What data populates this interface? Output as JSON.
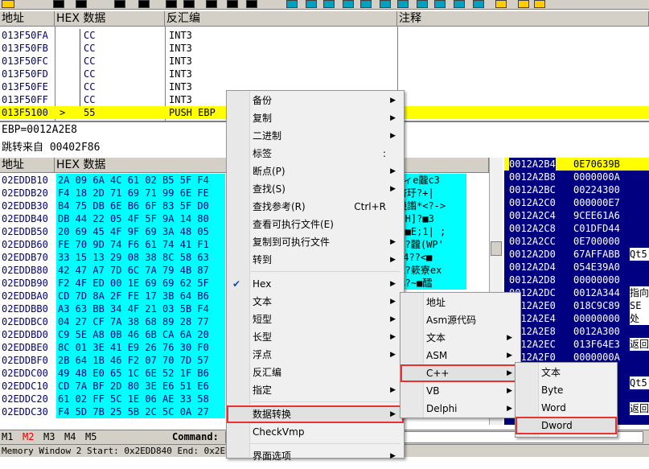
{
  "colors": {
    "cyan": "#00ffff",
    "navy": "#000080",
    "eip_yellow": "#ffff00",
    "menu_bg": "#f0f0f0",
    "highlight_red": "#e53333"
  },
  "disasm": {
    "headers": {
      "addr": "地址",
      "hex": "HEX 数据",
      "dis": "反汇编",
      "cmt": "注释"
    },
    "rows": [
      {
        "addr": "013F50FA",
        "hex": "CC",
        "dis": "INT3"
      },
      {
        "addr": "013F50FB",
        "hex": "CC",
        "dis": "INT3"
      },
      {
        "addr": "013F50FC",
        "hex": "CC",
        "dis": "INT3"
      },
      {
        "addr": "013F50FD",
        "hex": "CC",
        "dis": "INT3"
      },
      {
        "addr": "013F50FE",
        "hex": "CC",
        "dis": "INT3"
      },
      {
        "addr": "013F50FF",
        "hex": "CC",
        "dis": "INT3"
      },
      {
        "addr": "013F5100",
        "hex": "55",
        "dis": "PUSH EBP",
        "arrow": ">",
        "current": true
      }
    ]
  },
  "info": {
    "line1": "EBP=0012A2E8",
    "line2": "跳转来自  00402F86"
  },
  "dump": {
    "headers": {
      "addr": "地址",
      "hex": "HEX 数据"
    },
    "rows": [
      {
        "addr": "02EDDB10",
        "hex": "2A 09 6A 4C 61 02 B5 5F F4",
        "txt": "*磌ィe龖c3"
      },
      {
        "addr": "02EDDB20",
        "hex": "F4 18 2D 71 69 71 99 6E FE",
        "txt": "當脐玗?+|"
      },
      {
        "addr": "02EDDB30",
        "hex": "B4 75 DB 6E B6 6F 83 5F D0",
        "txt": "唚機譾*<?->"
      },
      {
        "addr": "02EDDB40",
        "hex": "DB 44 22 05 4F 5F 9A 14 80",
        "txt": "?@eH]?■3"
      },
      {
        "addr": "02EDDB50",
        "hex": "20 69 45 4F 9F 69 3A 48 05",
        "txt": "|:H■E;1| ;"
      },
      {
        "addr": "02EDDB60",
        "hex": "FE 70 9D 74 F6 61 74 41 F1",
        "txt": "lta?龖(WP'"
      },
      {
        "addr": "02EDDB70",
        "hex": "33 15 13 29 08 38 8C 58 63",
        "txt": "學V4??<■"
      },
      {
        "addr": "02EDDB80",
        "hex": "42 47 A7 7D 6C 7A 79 4B 87",
        "txt": "zyK?簌寮ex"
      },
      {
        "addr": "02EDDB90",
        "hex": "F2 4F ED 00 1E 69 69 62 5F",
        "txt": "b_%?~■醽"
      },
      {
        "addr": "02EDDBA0",
        "hex": "CD 7D 8A 2F FE 17 3B 64 B6",
        "txt": ""
      },
      {
        "addr": "02EDDBB0",
        "hex": "A3 63 BB 34 4F 21 03 5B F4",
        "txt": ""
      },
      {
        "addr": "02EDDBC0",
        "hex": "04 27 CF 7A 38 68 89 28 77",
        "txt": ""
      },
      {
        "addr": "02EDDBD0",
        "hex": "C9 5E A8 0B 46 6B CA 6A 20",
        "txt": ""
      },
      {
        "addr": "02EDDBE0",
        "hex": "8C 01 3E 41 E9 26 76 30 F0",
        "txt": ""
      },
      {
        "addr": "02EDDBF0",
        "hex": "2B 64 1B 46 F2 07 70 7D 57",
        "txt": ""
      },
      {
        "addr": "02EDDC00",
        "hex": "49 48 E0 65 1C 6E 52 1F B6",
        "txt": ""
      },
      {
        "addr": "02EDDC10",
        "hex": "CD 7A BF 2D 80 3E E6 51 E6",
        "txt": ""
      },
      {
        "addr": "02EDDC20",
        "hex": "61 02 FF 5C 1E 06 AE 33 58",
        "txt": ""
      },
      {
        "addr": "02EDDC30",
        "hex": "F4 5D 7B 25 5B 2C 5C 0A 27",
        "txt": ""
      }
    ]
  },
  "stack": {
    "rows": [
      {
        "addr": "0012A2B4",
        "val": "0E70639B",
        "cmt": "",
        "current": true
      },
      {
        "addr": "0012A2B8",
        "val": "0000000A",
        "cmt": ""
      },
      {
        "addr": "0012A2BC",
        "val": "00224300",
        "cmt": ""
      },
      {
        "addr": "0012A2C0",
        "val": "000000E7",
        "cmt": ""
      },
      {
        "addr": "0012A2C4",
        "val": "9CEE61A6",
        "cmt": ""
      },
      {
        "addr": "0012A2C8",
        "val": "C01DFD44",
        "cmt": ""
      },
      {
        "addr": "0012A2CC",
        "val": "0E700000",
        "cmt": ""
      },
      {
        "addr": "0012A2D0",
        "val": "67AFFABB",
        "cmt": "Qt5"
      },
      {
        "addr": "0012A2D4",
        "val": "054E39A0",
        "cmt": ""
      },
      {
        "addr": "0012A2D8",
        "val": "00000000",
        "cmt": ""
      },
      {
        "addr": "0012A2DC",
        "val": "0012A344",
        "cmt": "指向"
      },
      {
        "addr": "0012A2E0",
        "val": "018C9C89",
        "cmt": "SE处"
      },
      {
        "addr": "0012A2E4",
        "val": "00000000",
        "cmt": ""
      },
      {
        "addr": "0012A2E8",
        "val": "0012A300",
        "cmt": ""
      },
      {
        "addr": "0012A2EC",
        "val": "013F64E3",
        "cmt": "返回"
      },
      {
        "addr": "0012A2F0",
        "val": "0000000A",
        "cmt": ""
      },
      {
        "addr": "",
        "val": "",
        "cmt": ""
      },
      {
        "addr": "",
        "val": "",
        "cmt": "Qt5"
      },
      {
        "addr": "",
        "val": "",
        "cmt": ""
      },
      {
        "addr": "",
        "val": "",
        "cmt": "返回"
      }
    ]
  },
  "mtabs": {
    "m1": "M1",
    "m2": "M2",
    "m3": "M3",
    "m4": "M4",
    "m5": "M5",
    "command_label": "Command:"
  },
  "status": {
    "text": "Memory Window 2  Start: 0x2EDD840  End: 0x2EDC3F  Size:"
  },
  "menu1": {
    "items": [
      {
        "label": "备份",
        "submenu": true
      },
      {
        "label": "复制",
        "submenu": true
      },
      {
        "label": "二进制",
        "submenu": true
      },
      {
        "label": "标签",
        "shortcut": ":"
      },
      {
        "label": "断点(P)",
        "submenu": true
      },
      {
        "label": "查找(S)",
        "submenu": true
      },
      {
        "label": "查找参考(R)",
        "shortcut": "Ctrl+R"
      },
      {
        "label": "查看可执行文件(E)"
      },
      {
        "label": "复制到可执行文件",
        "submenu": true
      },
      {
        "label": "转到",
        "submenu": true
      },
      {
        "label": "Hex",
        "submenu": true,
        "checked": true
      },
      {
        "label": "文本",
        "submenu": true
      },
      {
        "label": "短型",
        "submenu": true
      },
      {
        "label": "长型",
        "submenu": true
      },
      {
        "label": "浮点",
        "submenu": true
      },
      {
        "label": "反汇编"
      },
      {
        "label": "指定",
        "submenu": true
      },
      {
        "label": "数据转换",
        "submenu": true,
        "highlighted": true
      },
      {
        "label": "CheckVmp"
      },
      {
        "label": "界面选项",
        "submenu": true
      }
    ]
  },
  "menu2": {
    "items": [
      {
        "label": "地址"
      },
      {
        "label": "Asm源代码"
      },
      {
        "label": "文本",
        "submenu": true
      },
      {
        "label": "ASM",
        "submenu": true
      },
      {
        "label": "C++",
        "submenu": true,
        "highlighted": true
      },
      {
        "label": "VB",
        "submenu": true
      },
      {
        "label": "Delphi",
        "submenu": true
      }
    ]
  },
  "menu3": {
    "items": [
      {
        "label": "文本"
      },
      {
        "label": "Byte"
      },
      {
        "label": "Word"
      },
      {
        "label": "Dword",
        "highlighted": true
      }
    ]
  }
}
